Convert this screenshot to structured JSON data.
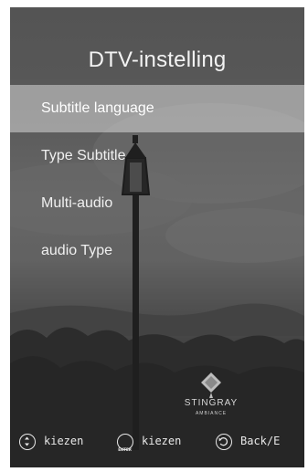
{
  "screen": {
    "title": "DTV-instelling"
  },
  "menu": {
    "items": [
      {
        "label": "Subtitle language",
        "selected": true
      },
      {
        "label": "Type Subtitle",
        "selected": false
      },
      {
        "label": "Multi-audio",
        "selected": false
      },
      {
        "label": "audio Type",
        "selected": false
      }
    ]
  },
  "branding": {
    "logo_text": "STINGRAY",
    "logo_subtext": "AMBIANCE"
  },
  "hints": {
    "navigate_label": "kiezen",
    "navigate_icon": "up-down-icon",
    "enter_label": "kiezen",
    "enter_icon_text": "ENTER",
    "enter_icon": "enter-icon",
    "back_label": "Back/E",
    "back_icon": "back-icon"
  },
  "colors": {
    "selection_highlight": "#b9b9b9",
    "text": "#f0f0f0"
  }
}
